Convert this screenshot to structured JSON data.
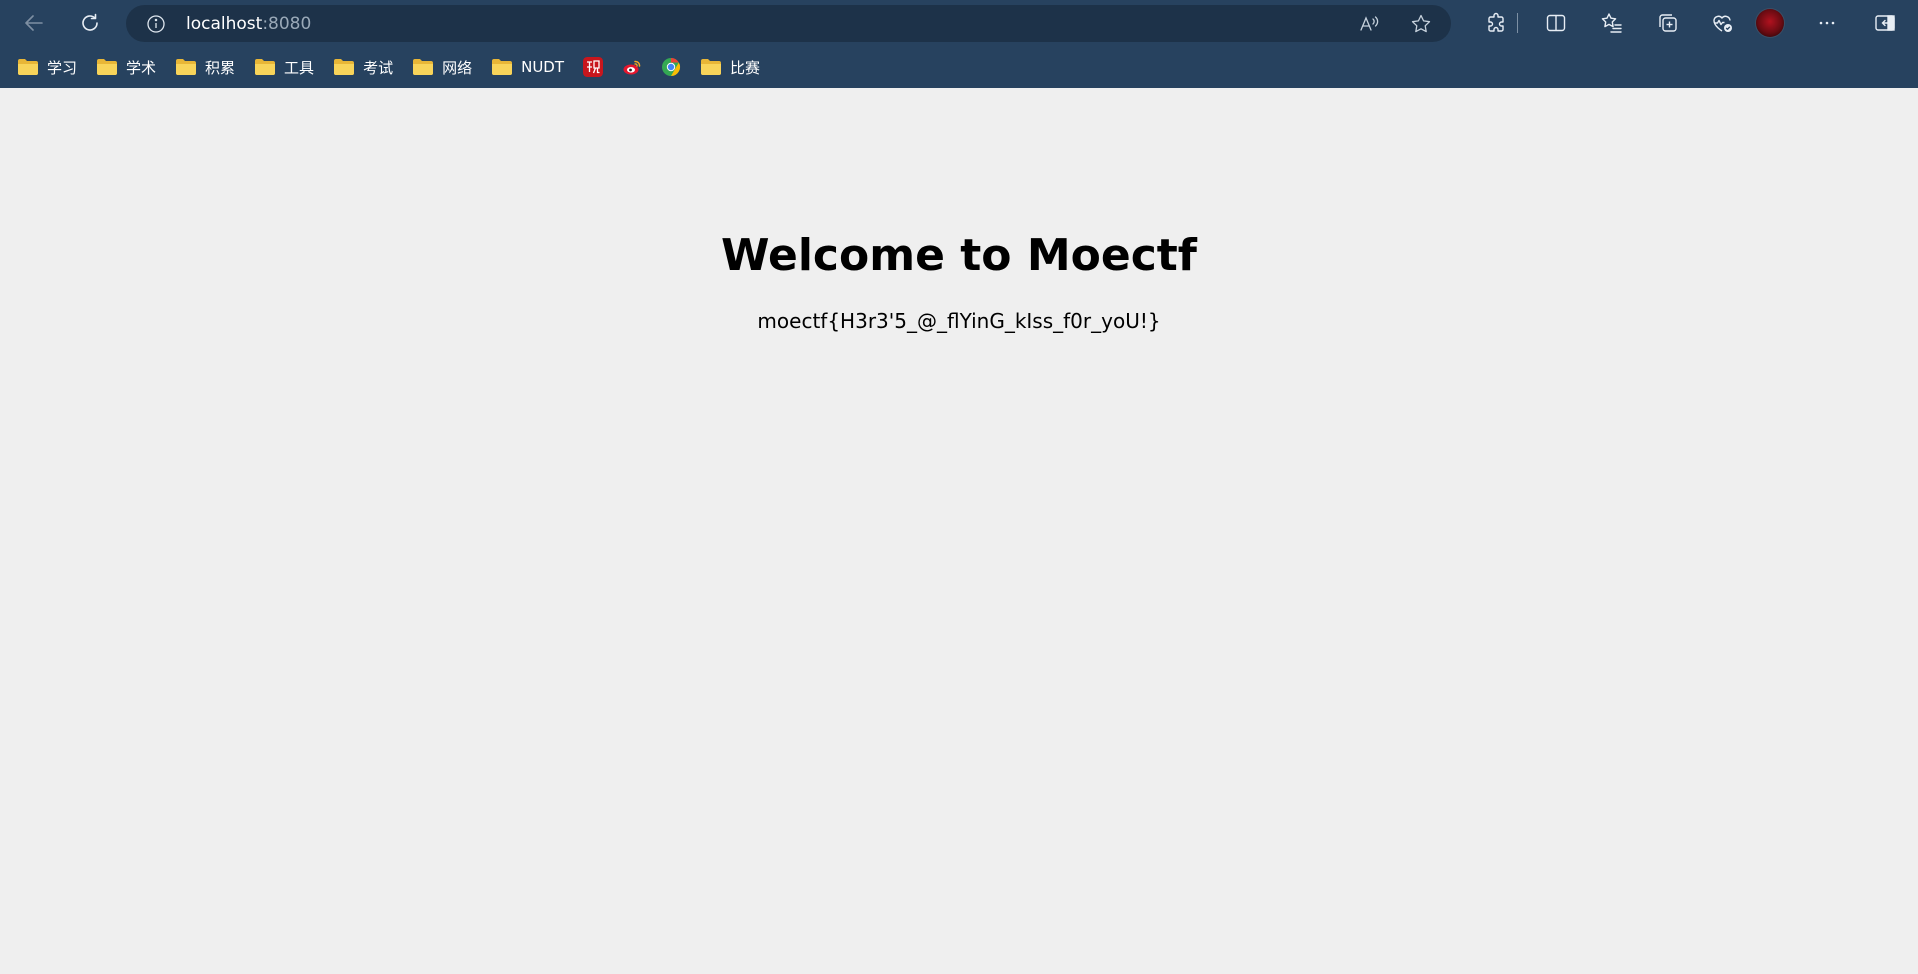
{
  "browser": {
    "address": {
      "host": "localhost",
      "port": ":8080"
    },
    "bookmarks": [
      {
        "label": "学习",
        "icon": "folder-icon"
      },
      {
        "label": "学术",
        "icon": "folder-icon"
      },
      {
        "label": "积累",
        "icon": "folder-icon"
      },
      {
        "label": "工具",
        "icon": "folder-icon"
      },
      {
        "label": "考试",
        "icon": "folder-icon"
      },
      {
        "label": "网络",
        "icon": "folder-icon"
      },
      {
        "label": "NUDT",
        "icon": "folder-icon"
      },
      {
        "label": "",
        "icon": "guan-site-icon"
      },
      {
        "label": "",
        "icon": "weibo-icon"
      },
      {
        "label": "",
        "icon": "chrome-like-site-icon"
      },
      {
        "label": "比赛",
        "icon": "folder-icon"
      }
    ],
    "toolbar_icons": [
      "extensions-icon",
      "split-screen-icon",
      "favorites-icon",
      "collections-icon",
      "browser-essentials-icon",
      "profile-avatar",
      "more-icon",
      "sidebar-icon"
    ],
    "colors": {
      "chrome_bg": "#27425f",
      "address_bg": "#1d3249",
      "page_bg": "#efefef"
    }
  },
  "page": {
    "title": "Welcome to Moectf",
    "flag": "moectf{H3r3'5_@_flYinG_kIss_f0r_yoU!}"
  }
}
